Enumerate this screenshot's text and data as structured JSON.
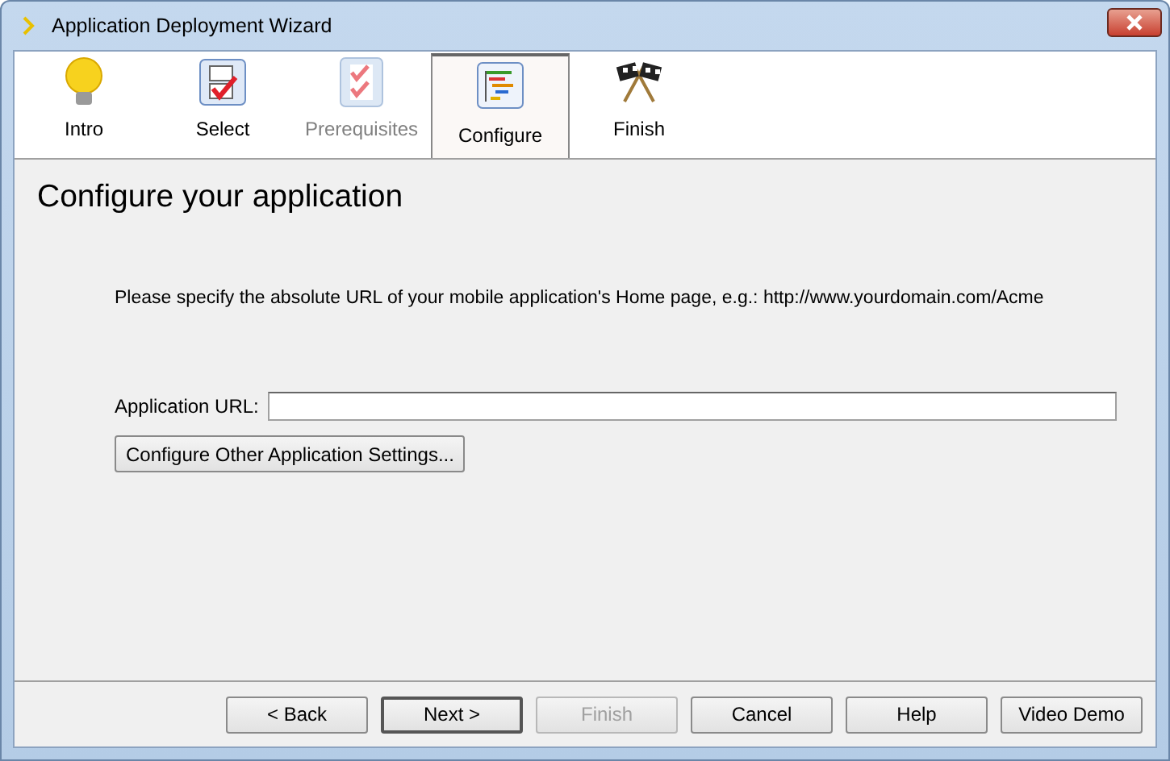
{
  "window": {
    "title": "Application Deployment Wizard"
  },
  "steps": [
    {
      "label": "Intro",
      "kind": "bulb",
      "selected": false,
      "disabled": false
    },
    {
      "label": "Select",
      "kind": "check",
      "selected": false,
      "disabled": false
    },
    {
      "label": "Prerequisites",
      "kind": "checklist",
      "selected": false,
      "disabled": true
    },
    {
      "label": "Configure",
      "kind": "config",
      "selected": true,
      "disabled": false
    },
    {
      "label": "Finish",
      "kind": "flags",
      "selected": false,
      "disabled": false
    }
  ],
  "heading": "Configure your application",
  "instruction": "Please specify the absolute URL of your mobile application's Home page, e.g.: http://www.yourdomain.com/Acme",
  "url_field": {
    "label": "Application URL:"
  },
  "settings_button": "Configure Other Application Settings...",
  "buttons": [
    {
      "label": "< Back",
      "disabled": false,
      "default": false
    },
    {
      "label": "Next >",
      "disabled": false,
      "default": true
    },
    {
      "label": "Finish",
      "disabled": true,
      "default": false
    },
    {
      "label": "Cancel",
      "disabled": false,
      "default": false
    },
    {
      "label": "Help",
      "disabled": false,
      "default": false
    },
    {
      "label": "Video Demo",
      "disabled": false,
      "default": false
    }
  ]
}
